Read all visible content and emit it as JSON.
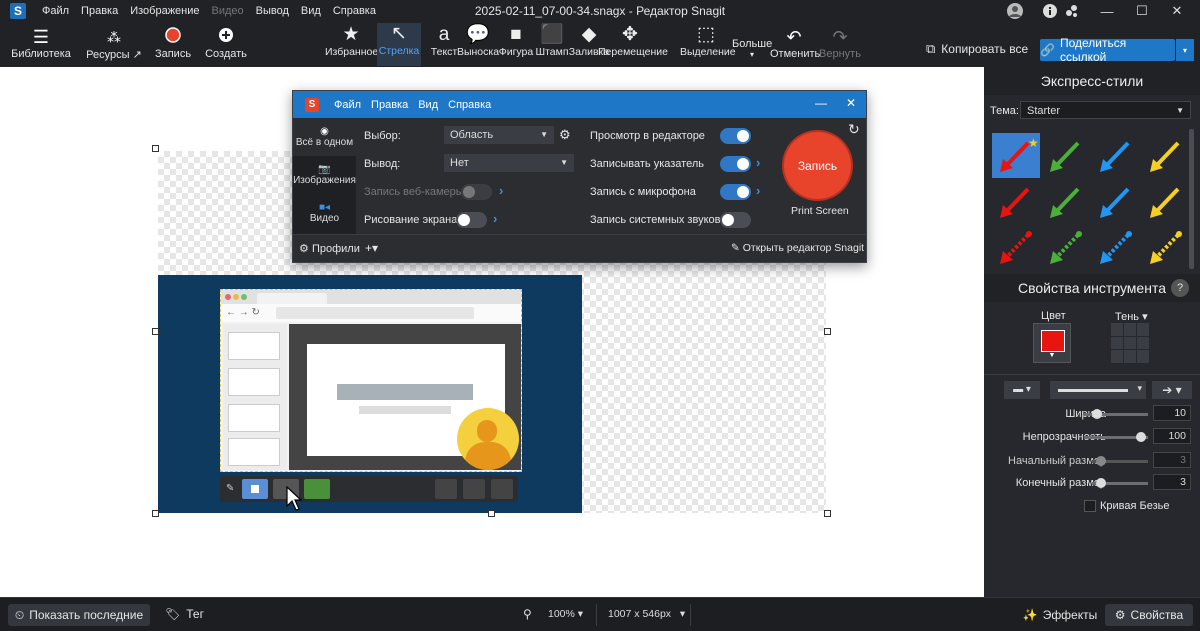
{
  "app": {
    "title": "2025-02-11_07-00-34.snagx - Редактор Snagit",
    "logo": "S"
  },
  "menu": [
    {
      "label": "Файл",
      "enabled": true
    },
    {
      "label": "Правка",
      "enabled": true
    },
    {
      "label": "Изображение",
      "enabled": true
    },
    {
      "label": "Видео",
      "enabled": false
    },
    {
      "label": "Вывод",
      "enabled": true
    },
    {
      "label": "Вид",
      "enabled": true
    },
    {
      "label": "Справка",
      "enabled": true
    }
  ],
  "toolbar_left": {
    "library": "Библиотека",
    "resources": "Ресурсы",
    "record": "Запись",
    "create": "Создать"
  },
  "tools": [
    {
      "label": "Избранное",
      "icon": "★"
    },
    {
      "label": "Стрелка",
      "icon": "↖",
      "selected": true
    },
    {
      "label": "Текст",
      "icon": "a"
    },
    {
      "label": "Выноска",
      "icon": "💬"
    },
    {
      "label": "Фигура",
      "icon": "■"
    },
    {
      "label": "Штамп",
      "icon": "⬛"
    },
    {
      "label": "Заливка",
      "icon": "◆"
    },
    {
      "label": "Перемещение",
      "icon": "✥"
    },
    {
      "label": "Выделение",
      "icon": "⬚"
    }
  ],
  "more": "Больше",
  "undo": "Отменить",
  "redo": "Вернуть",
  "copy_all": "Копировать все",
  "share": "Поделиться ссылкой",
  "capture": {
    "menu": [
      "Файл",
      "Правка",
      "Вид",
      "Справка"
    ],
    "modes": [
      "Всё в одном",
      "Изображения",
      "Видео"
    ],
    "selection_label": "Выбор:",
    "selection_value": "Область",
    "output_label": "Вывод:",
    "output_value": "Нет",
    "webcam": "Запись веб-камеры:",
    "draw": "Рисование экрана:",
    "preview": "Просмотр в редакторе",
    "cursor": "Записывать указатель",
    "mic": "Запись с микрофона",
    "sysaudio": "Запись системных звуков",
    "capture_btn": "Запись",
    "hotkey": "Print Screen",
    "profiles": "Профили",
    "open_editor": "Открыть редактор Snagit"
  },
  "panel": {
    "quick_styles": "Экспресс-стили",
    "theme_label": "Тема:",
    "theme_value": "Starter",
    "tool_props": "Свойства инструмента",
    "color_label": "Цвет",
    "shadow_label": "Тень",
    "color": "#e8140f",
    "width_label": "Ширина",
    "width_value": "10",
    "opacity_label": "Непрозрачность",
    "opacity_value": "100",
    "start_label": "Начальный размер",
    "start_value": "3",
    "end_label": "Конечный размер",
    "end_value": "3",
    "bezier": "Кривая Безье"
  },
  "status": {
    "show_recent": "Показать последние",
    "tag": "Тег",
    "zoom": "100%",
    "size": "1007 x 546px",
    "effects": "Эффекты",
    "properties": "Свойства"
  },
  "colors": {
    "accent": "#1f78c7",
    "record": "#e8432b",
    "canvas_blue": "#0e3a5f"
  }
}
